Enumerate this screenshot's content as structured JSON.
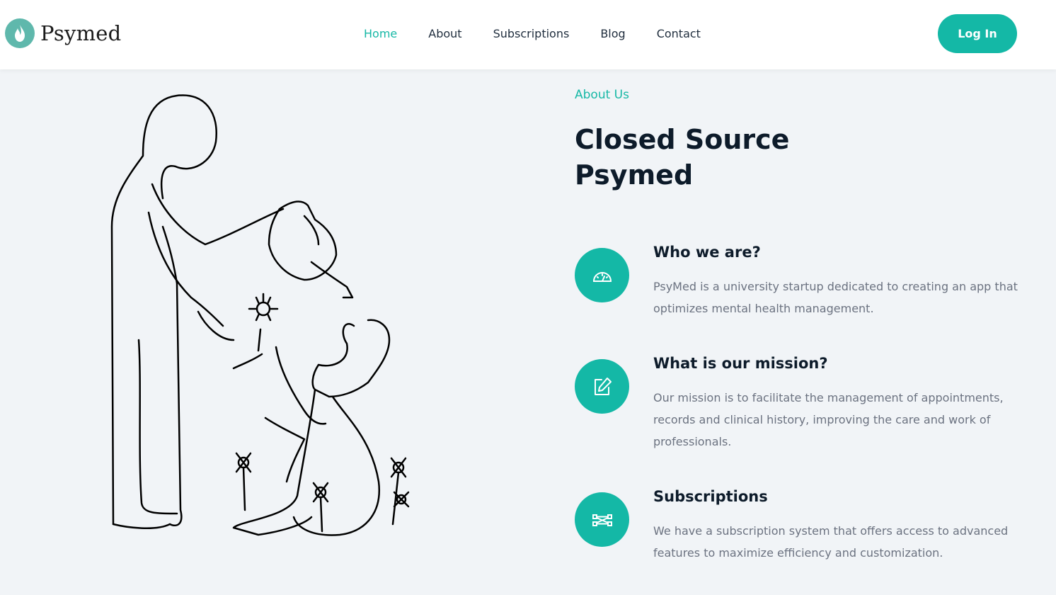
{
  "brand": {
    "name": "Psymed",
    "logo_icon": "flame-leaf-icon"
  },
  "nav": {
    "items": [
      {
        "label": "Home",
        "active": true
      },
      {
        "label": "About",
        "active": false
      },
      {
        "label": "Subscriptions",
        "active": false
      },
      {
        "label": "Blog",
        "active": false
      },
      {
        "label": "Contact",
        "active": false
      }
    ],
    "login_label": "Log In"
  },
  "about": {
    "eyebrow": "About Us",
    "title": "Closed Source Psymed",
    "features": [
      {
        "icon": "speedometer-icon",
        "title": "Who we are?",
        "description": "PsyMed is a university startup dedicated to creating an app that optimizes mental health management."
      },
      {
        "icon": "edit-note-icon",
        "title": "What is our mission?",
        "description": "Our mission is to facilitate the management of appointments, records and clinical history, improving the care and work of professionals."
      },
      {
        "icon": "nodes-icon",
        "title": "Subscriptions",
        "description": "We have a subscription system that offers access to advanced features to maximize efficiency and customization."
      }
    ]
  },
  "colors": {
    "accent": "#14b8a6",
    "background": "#f1f4f7",
    "heading": "#0d1b2a",
    "body_text": "#6b7280"
  }
}
